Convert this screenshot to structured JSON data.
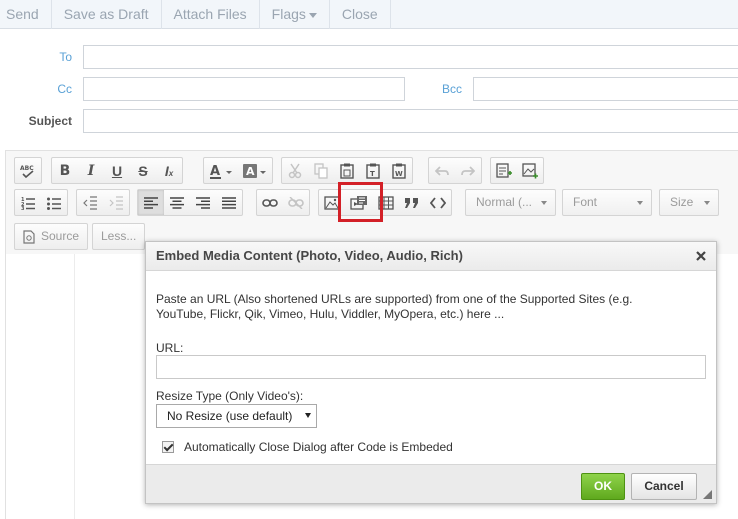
{
  "topbar": {
    "send": "Send",
    "save_draft": "Save as Draft",
    "attach": "Attach Files",
    "flags": "Flags",
    "close": "Close"
  },
  "fields": {
    "to_label": "To",
    "cc_label": "Cc",
    "bcc_label": "Bcc",
    "subject_label": "Subject"
  },
  "toolbar": {
    "format_combo": "Normal (...",
    "font_combo": "Font",
    "size_combo": "Size",
    "source_label": "Source",
    "less_label": "Less..."
  },
  "dialog": {
    "title": "Embed Media Content (Photo, Video, Audio, Rich)",
    "description": "Paste an URL (Also shortened URLs are supported) from one of the Supported Sites (e.g. YouTube, Flickr, Qik, Vimeo, Hulu, Viddler, MyOpera, etc.) here ...",
    "url_label": "URL:",
    "url_value": "",
    "resize_label": "Resize Type (Only Video's):",
    "resize_value": "No Resize (use default)",
    "auto_close_label": "Automatically Close Dialog after Code is Embeded",
    "auto_close_checked": true,
    "ok_label": "OK",
    "cancel_label": "Cancel"
  },
  "colors": {
    "field_label": "#5aa1d6",
    "ok_button": "#6ab82a",
    "highlight": "#d32027"
  }
}
